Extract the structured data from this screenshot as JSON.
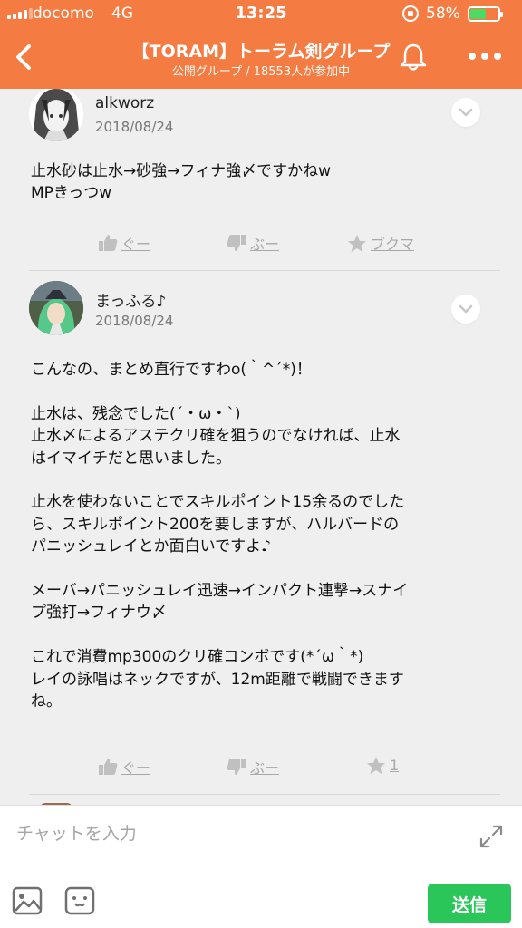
{
  "status_bar": {
    "carrier": "docomo",
    "network": "4G",
    "time": "13:25",
    "battery": "58%",
    "battery_level": 0.58
  },
  "nav": {
    "title": "【TORAM】トーラム剣グループ",
    "subtitle": "公開グループ / 18553人が参加中",
    "icons": [
      "back-icon",
      "bell-icon",
      "more-icon"
    ]
  },
  "posts": [
    {
      "username": "alkworz",
      "date": "2018/08/24",
      "lines": [
        "止水砂は止水→砂強→フィナ強〆ですかねw",
        "MPきっつw"
      ],
      "reactions": {
        "good": "ぐー",
        "boo": "ぶー",
        "bookmark": "ブクマ"
      }
    },
    {
      "username": "まっふる♪",
      "date": "2018/08/24",
      "lines": [
        "こんなの、まとめ直行ですわo(｀^´*)！",
        "",
        "止水は、残念でした(´・ω・`)",
        "止水〆によるアステクリ確を狙うのでなければ、止水",
        "はイマイチだと思いました。",
        "",
        "止水を使わないことでスキルポイント15余るのでした",
        "ら、スキルポイント200を要しますが、ハルバードの",
        "パニッシュレイとか面白いですよ♪",
        "",
        "メーバ→パニッシュレイ迅速→インパクト連撃→スナイ",
        "プ強打→フィナウ〆",
        "",
        "これで消費mp300のクリ確コンボです(*´ω｀*)",
        "レイの詠唱はネックですが、12m距離で戦闘できます",
        "ね。"
      ],
      "reactions": {
        "good": "ぐー",
        "boo": "ぶー",
        "bookmark": "1"
      }
    }
  ],
  "composer": {
    "placeholder": "チャットを入力",
    "send_label": "送信",
    "icons": [
      "expand-icon",
      "image-icon",
      "emoji-icon"
    ]
  },
  "colors": {
    "header": "#f47c42",
    "send": "#2bc65a",
    "battery": "#4cd964"
  }
}
